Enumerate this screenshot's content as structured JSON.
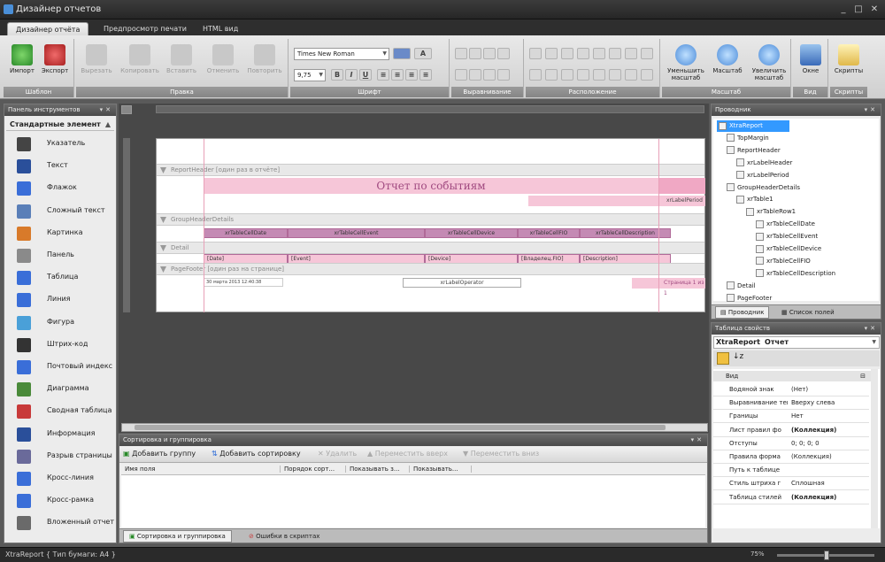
{
  "window": {
    "title": "Дизайнер отчетов",
    "controls": [
      "_",
      "□",
      "✕"
    ]
  },
  "ribbon_tabs": [
    {
      "label": "Дизайнер отчёта",
      "active": true
    },
    {
      "label": "Предпросмотр печати",
      "active": false
    },
    {
      "label": "HTML вид",
      "active": false
    }
  ],
  "ribbon": {
    "groups": {
      "template": "Шаблон",
      "edit": "Правка",
      "font": "Шрифт",
      "align": "Выравнивание",
      "layout": "Расположение",
      "zoom": "Масштаб",
      "view": "Вид",
      "scripts": "Скрипты"
    },
    "buttons": {
      "import": "Импорт",
      "export": "Экспорт",
      "cut": "Вырезать",
      "copy": "Копировать",
      "paste": "Вставить",
      "undo": "Отменить",
      "redo": "Повторить",
      "zoom_out": "Уменьшить масштаб",
      "zoom": "Масштаб",
      "zoom_in": "Увеличить масштаб",
      "windows": "Окне",
      "scripts": "Скрипты"
    },
    "font_name": "Times New Roman",
    "font_size": "9,75",
    "format_buttons": [
      "B",
      "I",
      "U"
    ]
  },
  "toolbox": {
    "title": "Панель инструментов",
    "section": "Стандартные элемент",
    "items": [
      {
        "label": "Указатель",
        "icon": "pointer-icon",
        "color": "#444444"
      },
      {
        "label": "Текст",
        "icon": "text-icon",
        "color": "#2a4f9a"
      },
      {
        "label": "Флажок",
        "icon": "checkbox-icon",
        "color": "#3a6ed8"
      },
      {
        "label": "Сложный текст",
        "icon": "rich-text-icon",
        "color": "#5a7fb8"
      },
      {
        "label": "Картинка",
        "icon": "picture-icon",
        "color": "#d87a2a"
      },
      {
        "label": "Панель",
        "icon": "panel-icon",
        "color": "#8a8a8a"
      },
      {
        "label": "Таблица",
        "icon": "table-icon",
        "color": "#3a6ed8"
      },
      {
        "label": "Линия",
        "icon": "line-icon",
        "color": "#3a6ed8"
      },
      {
        "label": "Фигура",
        "icon": "shape-icon",
        "color": "#4aa0d8"
      },
      {
        "label": "Штрих-код",
        "icon": "barcode-icon",
        "color": "#333333"
      },
      {
        "label": "Почтовый индекс",
        "icon": "zipcode-icon",
        "color": "#3a6ed8"
      },
      {
        "label": "Диаграмма",
        "icon": "chart-icon",
        "color": "#4a8a3a"
      },
      {
        "label": "Сводная таблица",
        "icon": "pivot-icon",
        "color": "#c83a3a"
      },
      {
        "label": "Информация",
        "icon": "info-icon",
        "color": "#2a4f9a"
      },
      {
        "label": "Разрыв страницы",
        "icon": "page-break-icon",
        "color": "#6a6a9a"
      },
      {
        "label": "Кросс-линия",
        "icon": "cross-line-icon",
        "color": "#3a6ed8"
      },
      {
        "label": "Кросс-рамка",
        "icon": "cross-band-icon",
        "color": "#3a6ed8"
      },
      {
        "label": "Вложенный отчет",
        "icon": "subreport-icon",
        "color": "#6a6a6a"
      }
    ]
  },
  "report": {
    "bands": {
      "report_header": "ReportHeader [один раз в отчёте]",
      "group_header": "GroupHeaderDetails",
      "detail": "Detail",
      "page_footer": "PageFooter [один раз на странице]"
    },
    "title_text": "Отчет по событиям",
    "period_cell": "xrLabelPeriod",
    "header_cells": [
      "xrTableCellDate",
      "xrTableCellEvent",
      "xrTableCellDevice",
      "xrTableCellFIO",
      "xrTableCellDescription"
    ],
    "detail_cells": [
      "[Date]",
      "[Event]",
      "[Device]",
      "[Владелец.FIO]",
      "[Description]"
    ],
    "footer_left": "30 марта 2013 12:40:38",
    "footer_mid": "xrLabelOperator",
    "footer_right": "Страница 1 из 1"
  },
  "sorting": {
    "title": "Сортировка и группировка",
    "buttons": {
      "add_group": "Добавить группу",
      "add_sort": "Добавить сортировку",
      "delete": "Удалить",
      "move_up": "Переместить вверх",
      "move_down": "Переместить вниз"
    },
    "columns": [
      "Имя поля",
      "Порядок сорт...",
      "Показывать з...",
      "Показывать..."
    ]
  },
  "bottom_tabs": [
    {
      "label": "Сортировка и группировка",
      "active": true
    },
    {
      "label": "Ошибки в скриптах",
      "active": false
    }
  ],
  "explorer": {
    "title": "Проводник",
    "nodes": [
      {
        "label": "XtraReport",
        "level": 0,
        "selected": true
      },
      {
        "label": "TopMargin",
        "level": 1,
        "selected": false
      },
      {
        "label": "ReportHeader",
        "level": 1,
        "selected": false
      },
      {
        "label": "xrLabelHeader",
        "level": 2,
        "selected": false
      },
      {
        "label": "xrLabelPeriod",
        "level": 2,
        "selected": false
      },
      {
        "label": "GroupHeaderDetails",
        "level": 1,
        "selected": false
      },
      {
        "label": "xrTable1",
        "level": 2,
        "selected": false
      },
      {
        "label": "xrTableRow1",
        "level": 3,
        "selected": false
      },
      {
        "label": "xrTableCellDate",
        "level": 4,
        "selected": false
      },
      {
        "label": "xrTableCellEvent",
        "level": 4,
        "selected": false
      },
      {
        "label": "xrTableCellDevice",
        "level": 4,
        "selected": false
      },
      {
        "label": "xrTableCellFIO",
        "level": 4,
        "selected": false
      },
      {
        "label": "xrTableCellDescription",
        "level": 4,
        "selected": false
      },
      {
        "label": "Detail",
        "level": 1,
        "selected": false
      },
      {
        "label": "PageFooter",
        "level": 1,
        "selected": false
      }
    ],
    "tabs": [
      {
        "label": "Проводник",
        "active": true
      },
      {
        "label": "Список полей",
        "active": false
      }
    ]
  },
  "properties": {
    "title": "Таблица свойств",
    "object_name": "XtraReport",
    "object_type": "Отчет",
    "category": "Вид",
    "rows": [
      {
        "key": "Водяной знак",
        "value": "(Нет)",
        "bold": false
      },
      {
        "key": "Выравнивание текс",
        "value": "Вверху слева",
        "bold": false
      },
      {
        "key": "Границы",
        "value": "Нет",
        "bold": false
      },
      {
        "key": "Лист правил фо",
        "value": "(Коллекция)",
        "bold": true
      },
      {
        "key": "Отступы",
        "value": "0; 0; 0; 0",
        "bold": false
      },
      {
        "key": "Правила форма",
        "value": "(Коллекция)",
        "bold": false
      },
      {
        "key": "Путь к таблице",
        "value": "",
        "bold": false
      },
      {
        "key": "Стиль штриха г",
        "value": "Сплошная",
        "bold": false
      },
      {
        "key": "Таблица стилей",
        "value": "(Коллекция)",
        "bold": true
      }
    ]
  },
  "status": {
    "text": "XtraReport { Тип бумаги: A4 }",
    "zoom": "75%"
  },
  "colors": {
    "accent": "#3399ff",
    "band_pink": "#f6c6d8",
    "table_header": "#c48ab4"
  }
}
